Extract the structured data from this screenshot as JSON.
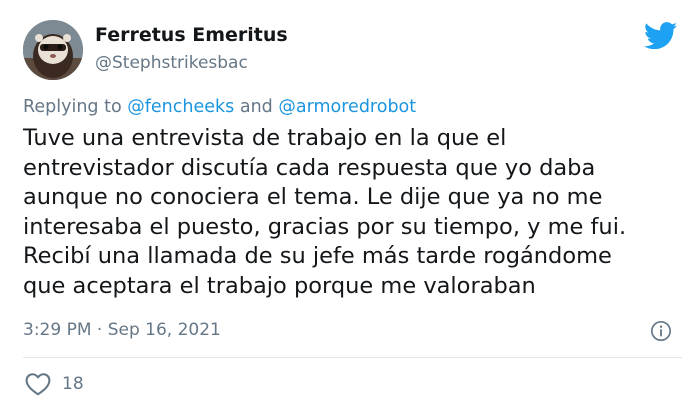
{
  "author": {
    "display_name": "Ferretus Emeritus",
    "handle": "@Stephstrikesbac",
    "avatar_icon": "ferret-photo",
    "brand_icon": "twitter-bird-icon"
  },
  "reply": {
    "prefix": "Replying to",
    "mentions": [
      "@fencheeks",
      "@armoredrobot"
    ],
    "joiner": "and"
  },
  "tweet": {
    "lines": [
      "Tuve una entrevista de trabajo en la que el",
      "entrevistador discutía cada respuesta que yo daba",
      "aunque no conociera el tema. Le dije que ya no me",
      "interesaba el puesto, gracias por su tiempo, y me fui.",
      "Recibí una llamada de su jefe más tarde rogándome",
      "que aceptara el trabajo porque me valoraban"
    ]
  },
  "meta": {
    "timestamp": "3:29 PM · Sep 16, 2021",
    "info_icon": "info-icon"
  },
  "actions": {
    "like_icon": "heart-icon",
    "like_count": "18"
  },
  "colors": {
    "twitter_blue": "#1da1f2",
    "mention_blue": "#1b95e0",
    "secondary_text": "#657786",
    "primary_text": "#14171a"
  }
}
